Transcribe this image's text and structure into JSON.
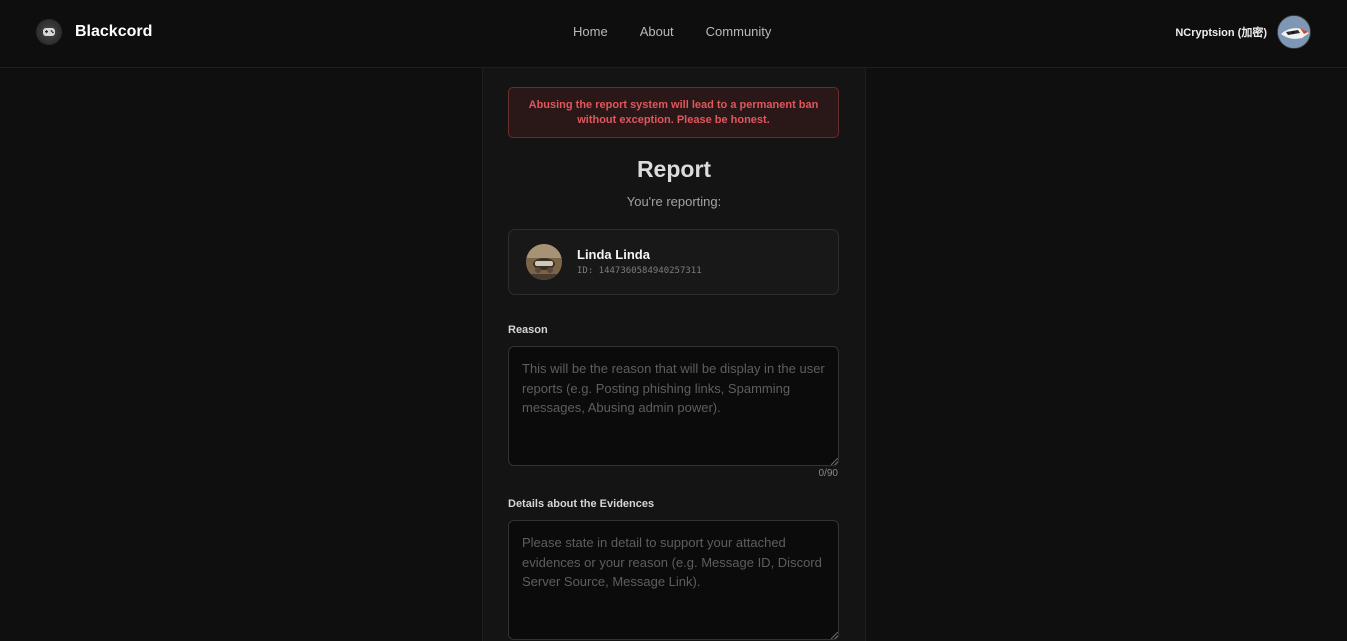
{
  "app": {
    "name": "Blackcord",
    "logo_icon": "game-controller-icon"
  },
  "nav": {
    "items": [
      {
        "label": "Home"
      },
      {
        "label": "About"
      },
      {
        "label": "Community"
      }
    ]
  },
  "user": {
    "name": "NCryptsion (加密)",
    "avatar_icon": "user-avatar"
  },
  "alert": {
    "text": "Abusing the report system will lead to a permanent ban without exception. Please be honest.",
    "color": "#e0575c"
  },
  "report": {
    "title": "Report",
    "subtitle": "You're reporting:",
    "target": {
      "name": "Linda Linda",
      "id": "ID: 1447360584940257311"
    },
    "reason": {
      "label": "Reason",
      "placeholder": "This will be the reason that will be display in the user reports (e.g. Posting phishing links, Spamming messages, Abusing admin power).",
      "value": "",
      "counter": "0/90"
    },
    "evidence": {
      "label": "Details about the Evidences",
      "placeholder": "Please state in detail to support your attached evidences or your reason (e.g. Message ID, Discord Server Source, Message Link).",
      "value": ""
    }
  },
  "colors": {
    "background": "#0f0f0f",
    "panel": "#141414",
    "alert_bg": "#2a1718",
    "alert_border": "#6a2b2e"
  }
}
